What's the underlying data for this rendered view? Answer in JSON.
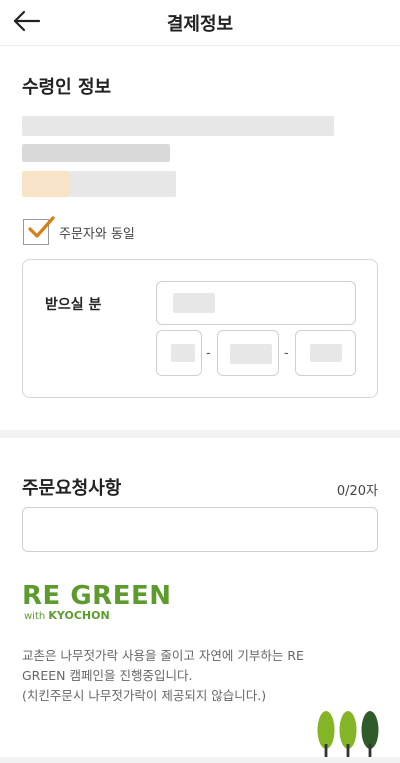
{
  "header": {
    "title": "결제정보"
  },
  "recipient": {
    "section_title": "수령인 정보",
    "same_as_orderer_label": "주문자와 동일",
    "same_as_orderer_checked": true,
    "receiver_label": "받으실 분"
  },
  "request": {
    "section_title": "주문요청사항",
    "counter": "0/20자"
  },
  "campaign": {
    "logo_title": "RE GREEN",
    "logo_with": "with",
    "logo_brand": "KYOCHON",
    "lines": [
      "교촌은 나무젓가락 사용을 줄이고 자연에 기부하는 RE",
      "GREEN 캠페인을 진행중입니다.",
      "(치킨주문시 나무젓가락이 제공되지 않습니다.)"
    ]
  },
  "colors": {
    "brand_green": "#5e9b2f",
    "check_orange": "#d97e17",
    "tree_light": "#84b526",
    "tree_dark": "#2f5a2a"
  },
  "icons": {
    "back": "arrow-left-icon",
    "check": "check-icon",
    "trees": "trees-icon"
  }
}
